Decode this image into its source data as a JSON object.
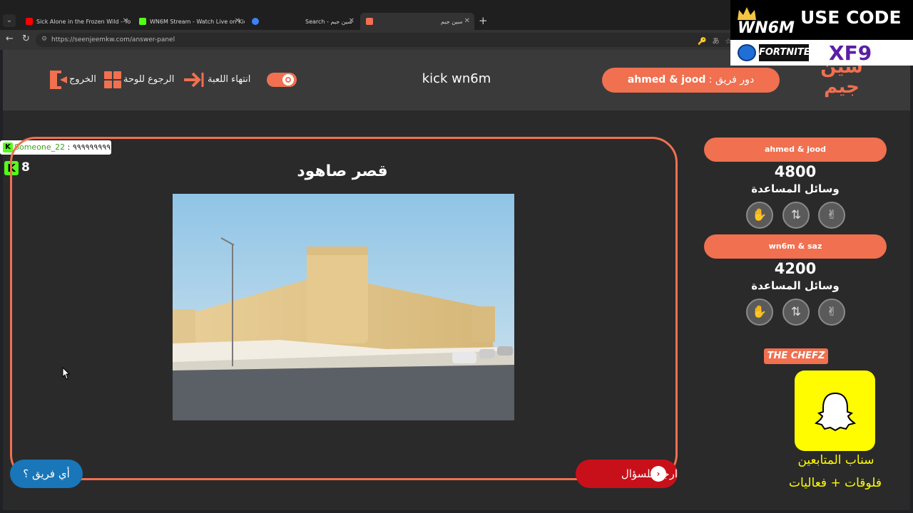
{
  "browser": {
    "tabs": [
      {
        "title": "Sick Alone in the Frozen Wild - Yo",
        "fav_color": "#ff0000"
      },
      {
        "title": "WN6M Stream - Watch Live on Kic",
        "fav_color": "#53fc18"
      },
      {
        "title": "Search - سين جيم",
        "fav_color": "#3b82f6"
      },
      {
        "title": "سين جيم",
        "fav_color": "#f07050"
      }
    ],
    "url": "https://seenjeemkw.com/answer-panel"
  },
  "promo": {
    "label": "USE CODE",
    "brand": "WN6M",
    "game": "FORTNITE",
    "code": "XF9"
  },
  "header": {
    "exit_label": "الخروج",
    "back_board_label": "الرجوع للوحة",
    "end_game_label": "انتهاء اللعبة",
    "stream_title": "kick wn6m",
    "turn_prefix": "دور فريق : ",
    "turn_team": "ahmed & jood",
    "logo_text": "سين جيم"
  },
  "chat": {
    "user": "Someone_22",
    "message": " : ٩٩٩٩٩٩٩٩٩",
    "viewers": "8"
  },
  "question": {
    "title": "قصر صاهود",
    "back_label": "ارجع للسؤال",
    "which_team_label": "أي فريق ؟"
  },
  "teams": [
    {
      "name": "ahmed & jood",
      "score": "4800",
      "aids_label": "وسائل المساعدة"
    },
    {
      "name": "wn6m & saz",
      "score": "4200",
      "aids_label": "وسائل المساعدة"
    }
  ],
  "sponsor": {
    "chefz": "THE CHEFZ",
    "snap_line1": "سناب  المتابعين",
    "snap_line2": "فلوقات  +  فعاليات"
  },
  "colors": {
    "accent": "#f07050",
    "danger": "#c8101a",
    "info": "#1976b8",
    "snap": "#fffc00"
  }
}
